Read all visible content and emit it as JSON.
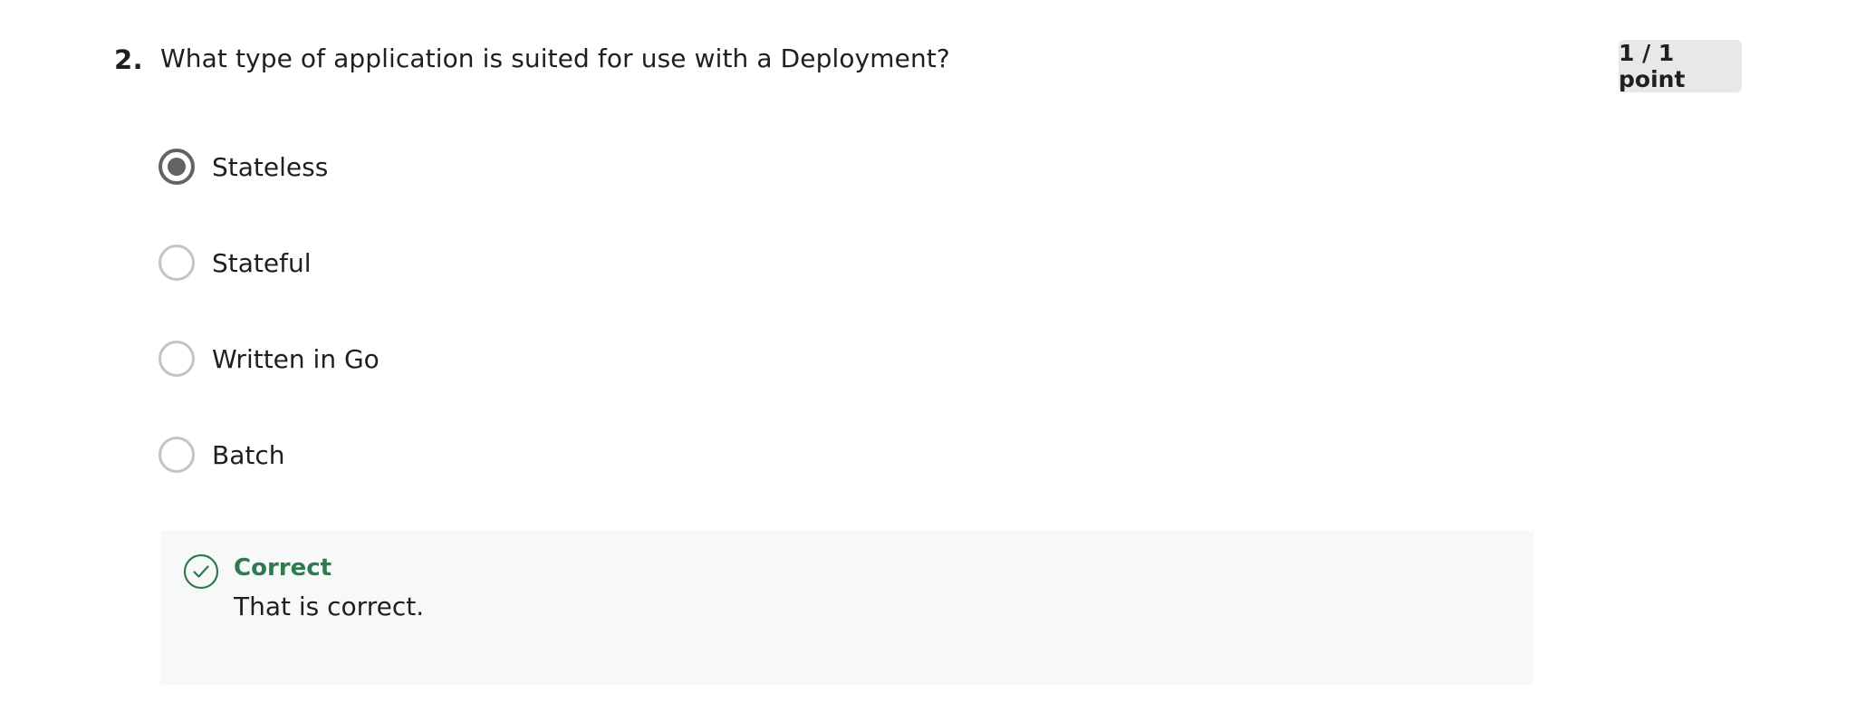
{
  "question": {
    "number": "2.",
    "text": "What type of application is suited for use with a Deployment?",
    "points": "1 / 1 point",
    "options": [
      {
        "label": "Stateless",
        "selected": true
      },
      {
        "label": "Stateful",
        "selected": false
      },
      {
        "label": "Written in Go",
        "selected": false
      },
      {
        "label": "Batch",
        "selected": false
      }
    ]
  },
  "feedback": {
    "icon": "check-circle-icon",
    "status": "Correct",
    "message": "That is correct.",
    "status_color": "#2f7a4f"
  }
}
